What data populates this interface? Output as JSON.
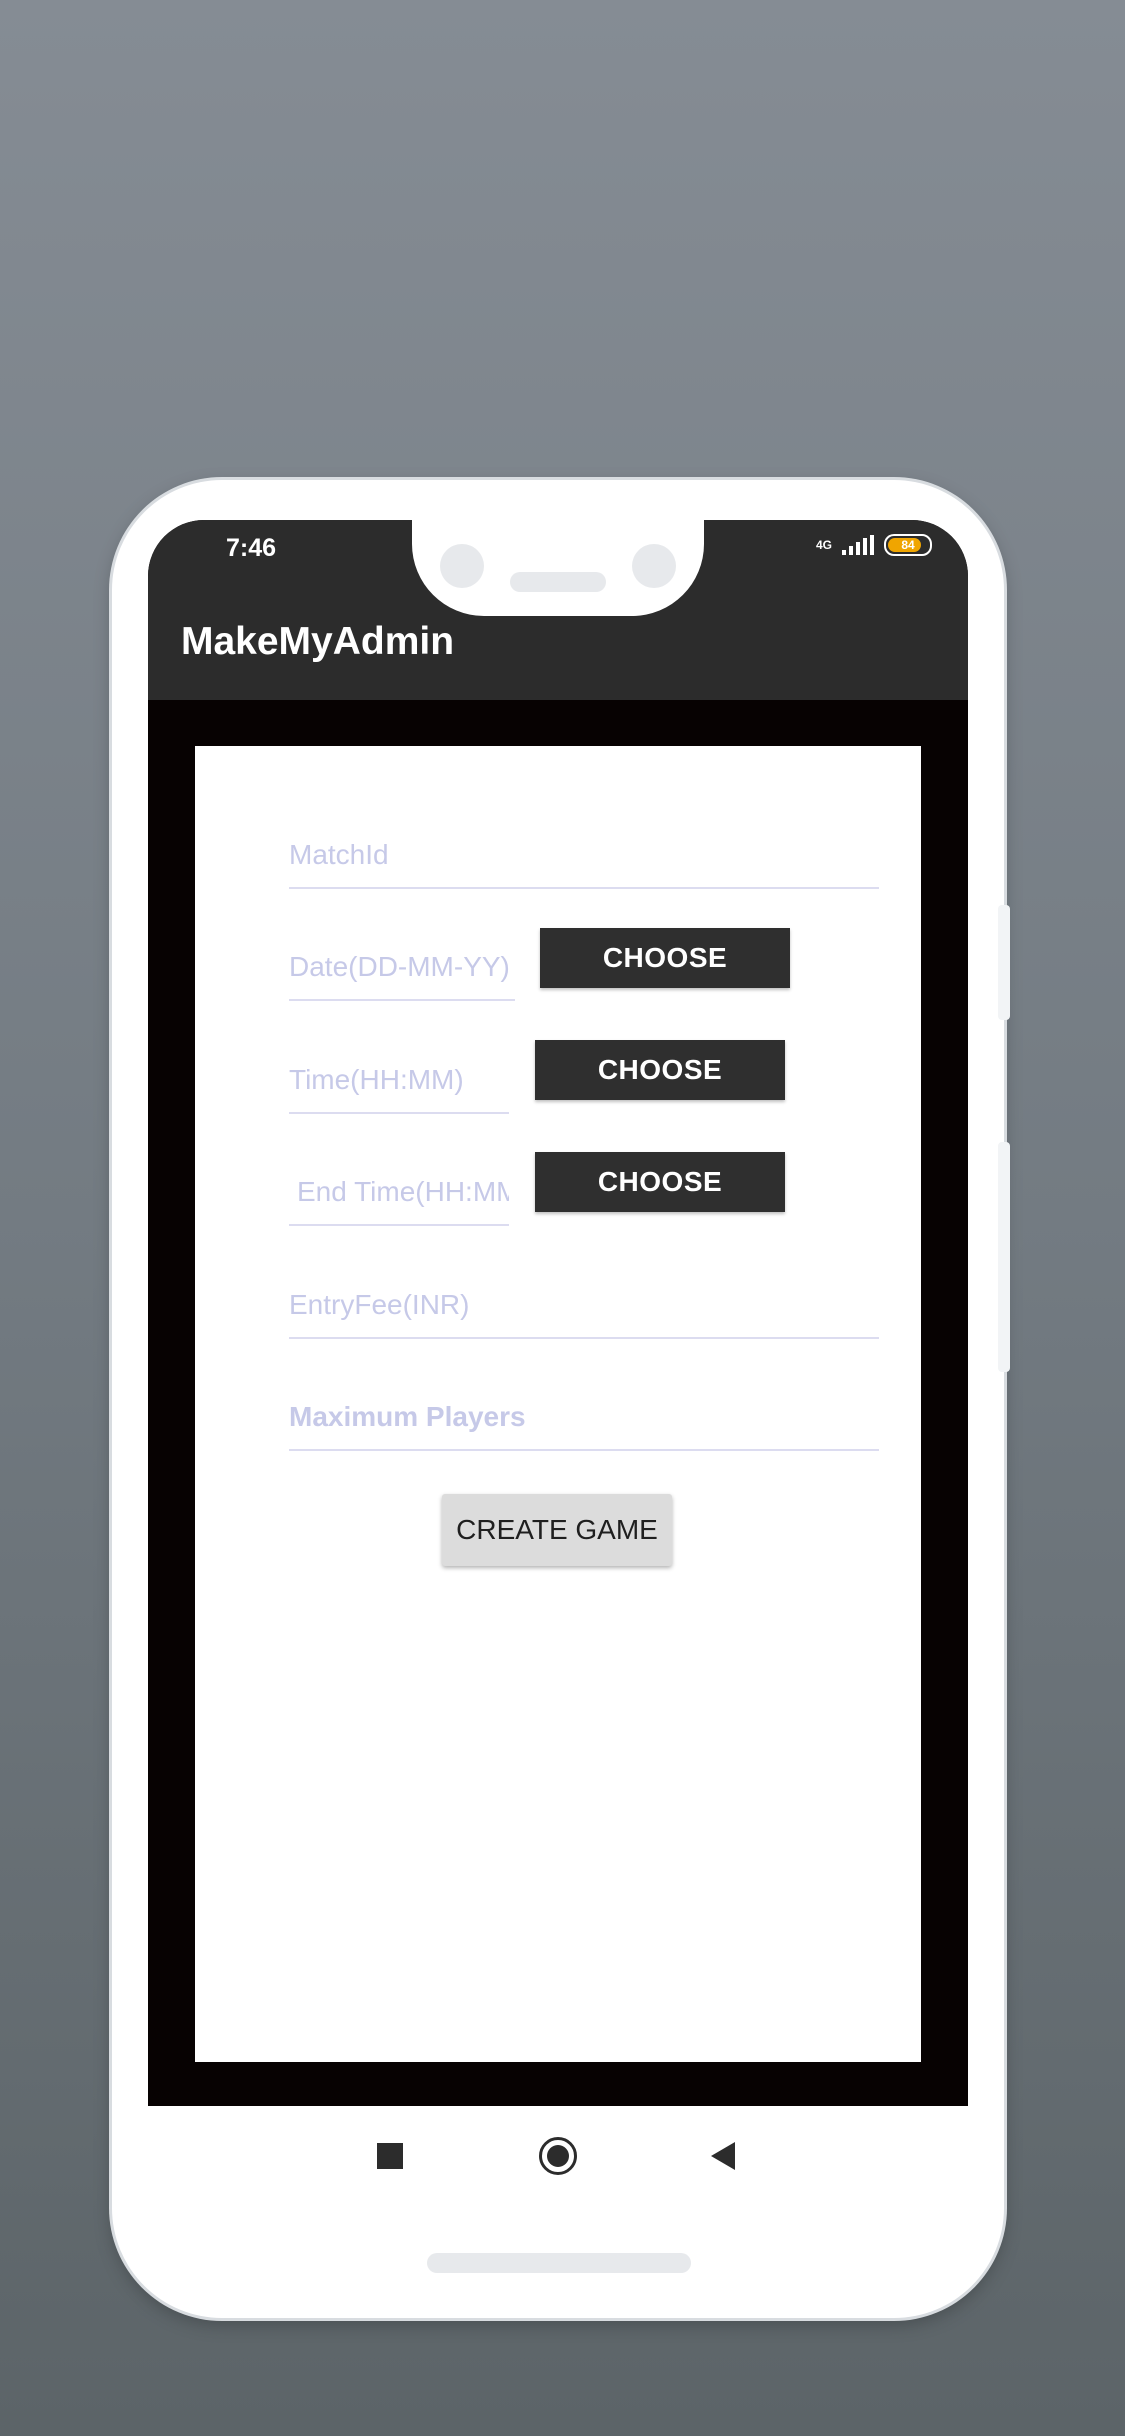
{
  "status_bar": {
    "time": "7:46",
    "network": "4G",
    "battery": "84"
  },
  "app_bar": {
    "title": "MakeMyAdmin"
  },
  "form": {
    "match_id": {
      "placeholder": "MatchId",
      "value": ""
    },
    "date": {
      "placeholder": "Date(DD-MM-YY)",
      "button_label": "CHOOSE"
    },
    "time": {
      "placeholder": "Time(HH:MM)",
      "button_label": "CHOOSE"
    },
    "end_time": {
      "placeholder": "End Time(HH:MM)",
      "button_label": "CHOOSE"
    },
    "entry_fee": {
      "placeholder": "EntryFee(INR)",
      "value": ""
    },
    "max_players": {
      "placeholder": "Maximum Players",
      "value": ""
    },
    "submit_label": "CREATE GAME"
  },
  "nav_bar": {
    "recents": "square-icon",
    "home": "circle-icon",
    "back": "triangle-back-icon"
  },
  "colors": {
    "app_bar": "#2c2c2c",
    "screen_bg": "#070202",
    "button_dark": "#2f2f2f",
    "placeholder": "#c6c9e8",
    "battery": "#f0a500"
  }
}
